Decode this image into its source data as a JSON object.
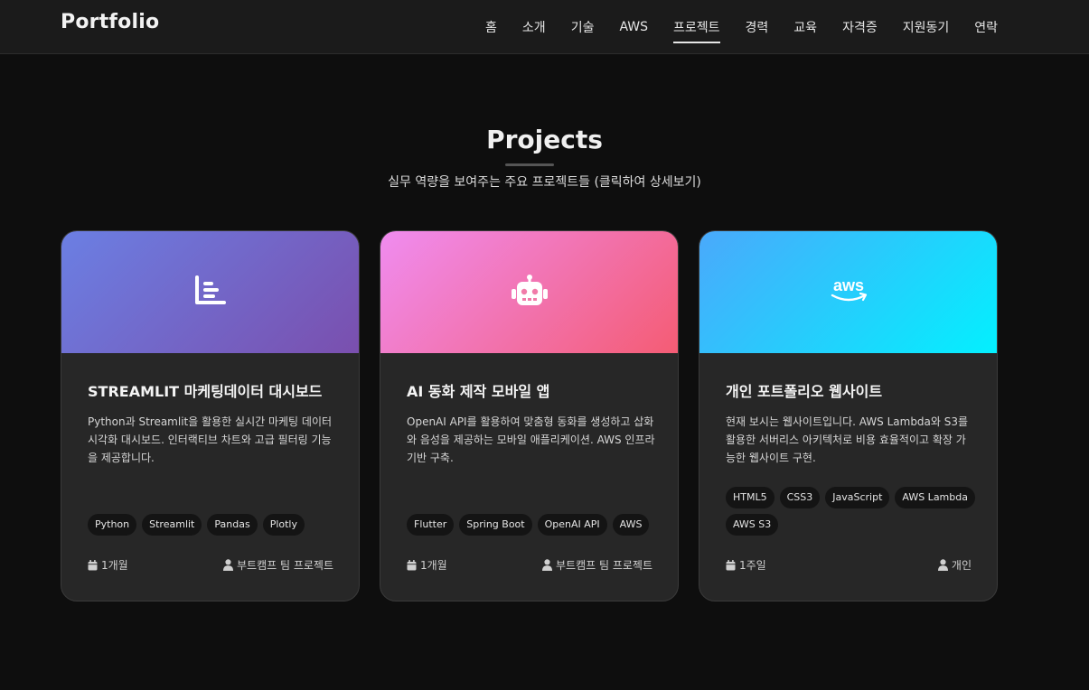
{
  "logo": "Portfolio",
  "nav": [
    {
      "label": "홈",
      "name": "home",
      "active": false
    },
    {
      "label": "소개",
      "name": "about",
      "active": false
    },
    {
      "label": "기술",
      "name": "skills",
      "active": false
    },
    {
      "label": "AWS",
      "name": "aws",
      "active": false
    },
    {
      "label": "프로젝트",
      "name": "projects",
      "active": true
    },
    {
      "label": "경력",
      "name": "career",
      "active": false
    },
    {
      "label": "교육",
      "name": "education",
      "active": false
    },
    {
      "label": "자격증",
      "name": "certificates",
      "active": false
    },
    {
      "label": "지원동기",
      "name": "motivation",
      "active": false
    },
    {
      "label": "연락",
      "name": "contact",
      "active": false
    }
  ],
  "section": {
    "title": "Projects",
    "subtitle": "실무 역량을 보여주는 주요 프로젝트들 (클릭하여 상세보기)"
  },
  "projects": [
    {
      "title": "STREAMLIT 마케팅데이터 대시보드",
      "description": "Python과 Streamlit을 활용한 실시간 마케팅 데이터 시각화 대시보드. 인터랙티브 차트와 고급 필터링 기능을 제공합니다.",
      "tags": [
        "Python",
        "Streamlit",
        "Pandas",
        "Plotly"
      ],
      "duration": "1개월",
      "team": "부트캠프 팀 프로젝트",
      "icon": "chart-line-icon",
      "gradient": [
        "#6b7fe3",
        "#7a4fae"
      ]
    },
    {
      "title": "AI 동화 제작 모바일 앱",
      "description": "OpenAI API를 활용하여 맞춤형 동화를 생성하고 삽화와 음성을 제공하는 모바일 애플리케이션. AWS 인프라 기반 구축.",
      "tags": [
        "Flutter",
        "Spring Boot",
        "OpenAI API",
        "AWS"
      ],
      "duration": "1개월",
      "team": "부트캠프 팀 프로젝트",
      "icon": "robot-icon",
      "gradient": [
        "#f08cf0",
        "#f45c74"
      ]
    },
    {
      "title": "개인 포트폴리오 웹사이트",
      "description": "현재 보시는 웹사이트입니다. AWS Lambda와 S3를 활용한 서버리스 아키텍처로 비용 효율적이고 확장 가능한 웹사이트 구현.",
      "tags": [
        "HTML5",
        "CSS3",
        "JavaScript",
        "AWS Lambda",
        "AWS S3"
      ],
      "duration": "1주일",
      "team": "개인",
      "icon": "aws-logo-icon",
      "gradient": [
        "#4aa9fb",
        "#03f0fe"
      ]
    }
  ]
}
